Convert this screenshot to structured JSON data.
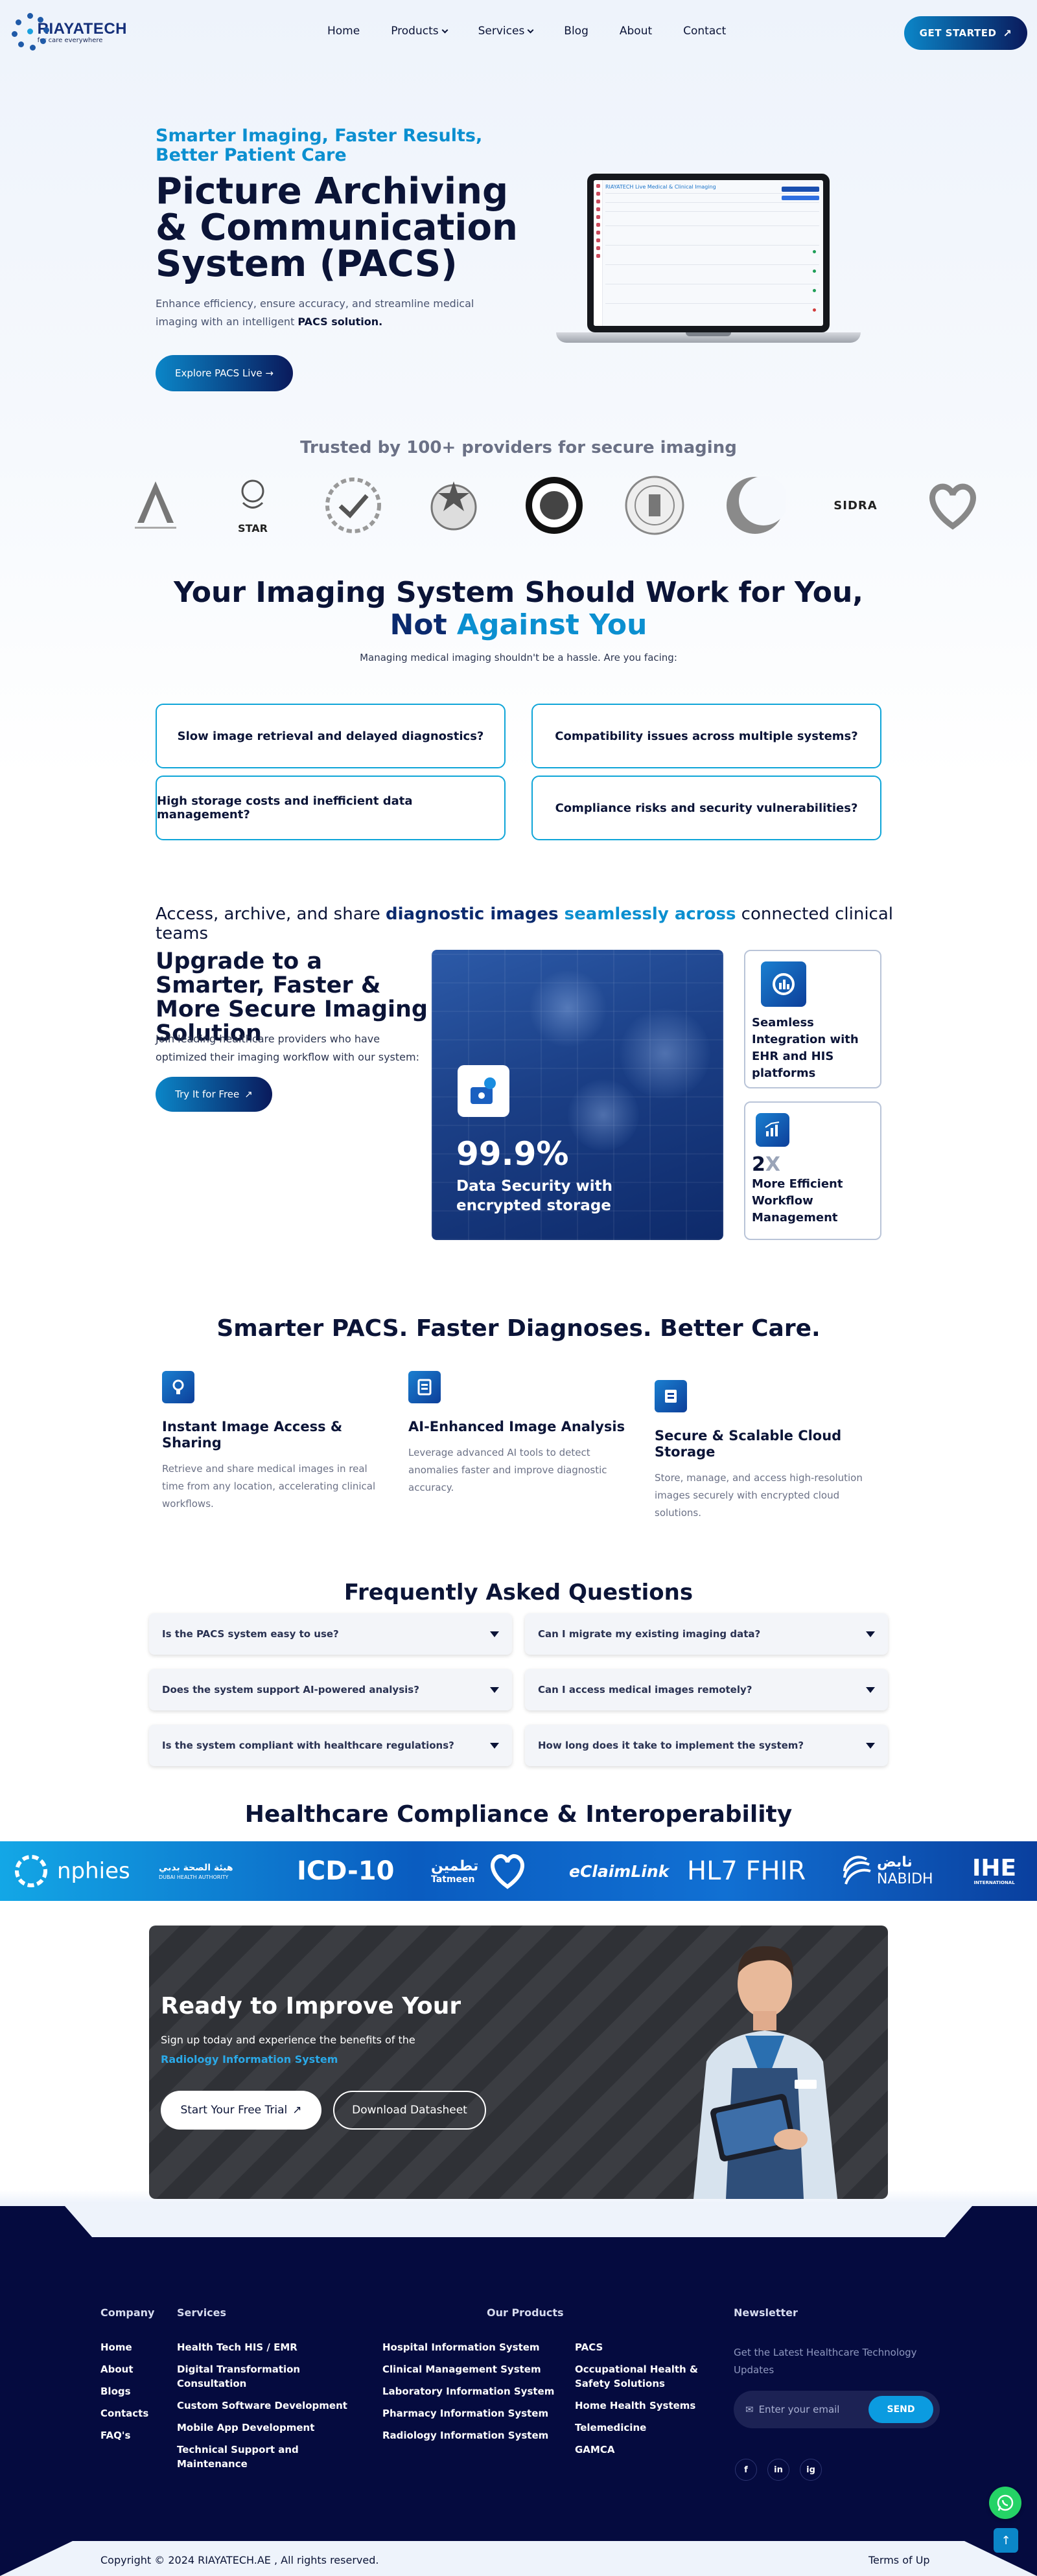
{
  "header": {
    "logo_name": "RIAYATECH",
    "logo_tagline": "for care everywhere",
    "nav": [
      "Home",
      "Products",
      "Services",
      "Blog",
      "About",
      "Contact"
    ],
    "cta_label": "GET STARTED"
  },
  "hero": {
    "kicker": "Smarter Imaging, Faster Results, Better Patient Care",
    "title": "Picture Archiving & Communication System (PACS)",
    "desc_prefix": "Enhance efficiency, ensure accuracy, and streamline medical imaging with an intelligent ",
    "desc_bold": "PACS solution.",
    "button": "Explore PACS Live",
    "screen_title": "RIAYATECH Live Medical & Clinical Imaging"
  },
  "trusted": {
    "title": "Trusted by 100+ providers for secure imaging",
    "partners": [
      "partner-a-logo",
      "star-healthcare-logo",
      "check-seal-logo",
      "emblem-logo",
      "shield-round-logo",
      "hospital-seal-logo",
      "crescent-logo",
      "sidra-logo",
      "heart-hands-logo"
    ],
    "sidra_text": "SIDRA",
    "star_text": "STAR"
  },
  "challenges": {
    "title_line1": "Your Imaging System Should Work for You,",
    "title_line2a": "Not ",
    "title_line2b": "Against You",
    "subtitle": "Managing medical imaging shouldn't be a hassle. Are you facing:",
    "items": [
      "Slow image retrieval and delayed diagnostics?",
      "Compatibility issues across multiple systems?",
      "High storage costs and inefficient data management?",
      "Compliance risks and security vulnerabilities?"
    ]
  },
  "upgrade": {
    "access_prefix": "Access, archive, and share ",
    "access_hl1": "diagnostic images ",
    "access_hl2": "seamlessly across",
    "access_suffix": " connected clinical teams",
    "title": "Upgrade to a Smarter, Faster & More Secure Imaging Solution",
    "desc": "Join leading healthcare providers who have optimized their imaging workflow with our system:",
    "button": "Try It for Free",
    "stat_value": "99.9%",
    "stat_label": "Data Security with encrypted storage",
    "card1_title": "Seamless Integration with EHR and HIS platforms",
    "card2_value_a": "2",
    "card2_value_b": "X",
    "card2_title": "More Efficient Workflow Management"
  },
  "smarter": {
    "title": "Smarter PACS. Faster Diagnoses. Better Care.",
    "features": [
      {
        "title": "Instant Image Access & Sharing",
        "desc": "Retrieve and share medical images in real time from any location, accelerating clinical workflows."
      },
      {
        "title": "AI-Enhanced Image Analysis",
        "desc": "Leverage advanced AI tools to detect anomalies faster and improve diagnostic accuracy."
      },
      {
        "title": "Secure & Scalable Cloud Storage",
        "desc": "Store, manage, and access high-resolution images securely with encrypted cloud solutions."
      }
    ]
  },
  "faq": {
    "title": "Frequently Asked Questions",
    "items": [
      "Is the PACS system easy to use?",
      "Can I migrate my existing imaging data?",
      "Does the system support AI-powered analysis?",
      "Can I access medical images remotely?",
      "Is the system compliant with healthcare regulations?",
      "How long does it take to implement the system?"
    ]
  },
  "compliance": {
    "title": "Healthcare Compliance & Interoperability",
    "logos": [
      "nphies",
      "DUBAI HEALTH AUTHORITY",
      "ICD-10",
      "Tatmeen",
      "eClaimLink",
      "HL7 FHIR",
      "NABIDH",
      "IHE"
    ],
    "dha_arabic": "هيئة الصحة بدبي",
    "tatmeen_arabic": "تطمين",
    "nabidh_arabic": "نابض",
    "ihe_sub": "INTERNATIONAL"
  },
  "cta": {
    "title": "Ready to Improve Your",
    "desc_prefix": "Sign up today and experience the benefits of the ",
    "desc_hl": "Radiology Information System",
    "button1": "Start Your Free Trial",
    "button2": "Download Datasheet"
  },
  "footer": {
    "company_heading": "Company",
    "company_links": [
      "Home",
      "About",
      "Blogs",
      "Contacts",
      "FAQ's"
    ],
    "services_heading": "Services",
    "services_links": [
      "Health Tech HIS / EMR",
      "Digital Transformation Consultation",
      "Custom Software Development",
      "Mobile App Development",
      "Technical Support and Maintenance"
    ],
    "products_heading": "Our Products",
    "products_col1": [
      "Hospital Information System",
      "Clinical Management System",
      "Laboratory Information System",
      "Pharmacy Information System",
      "Radiology Information System"
    ],
    "products_col2": [
      "PACS",
      "Occupational Health & Safety Solutions",
      "Home Health Systems",
      "Telemedicine",
      "GAMCA"
    ],
    "newsletter_heading": "Newsletter",
    "newsletter_text": "Get the Latest Healthcare Technology Updates",
    "email_placeholder": "Enter your email",
    "send_label": "SEND",
    "social": [
      "f",
      "in",
      "ig"
    ],
    "copyright": "Copyright © 2024 RIAYATECH.AE , All rights reserved.",
    "terms": "Terms of Up"
  },
  "colors": {
    "primary": "#0a1a5c",
    "accent": "#0b8fd0",
    "footer_bg": "#050b3f",
    "whatsapp": "#25d366"
  }
}
